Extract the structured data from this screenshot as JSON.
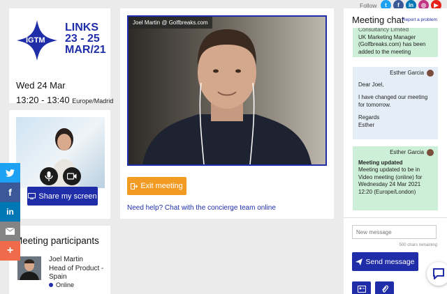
{
  "event": {
    "logo_acronym": "IGTM",
    "logo_line1": "LINKS",
    "logo_line2": "23 - 25",
    "logo_line3": "MAR/21",
    "date": "Wed 24 Mar",
    "time": "13:20 - 13:40",
    "timezone": "Europe/Madrid"
  },
  "self_video": {
    "mic_icon": "microphone-icon",
    "camera_icon": "video-camera-icon",
    "share_label": "Share my screen"
  },
  "participants": {
    "title": "Meeting participants",
    "items": [
      {
        "name": "Joel Martin",
        "role": "Head of Product - Spain",
        "status": "Online"
      }
    ]
  },
  "share_sidebar": [
    {
      "icon": "twitter-icon",
      "color": "#1da1f2"
    },
    {
      "icon": "facebook-icon",
      "color": "#3b5998"
    },
    {
      "icon": "linkedin-icon",
      "color": "#0077b5"
    },
    {
      "icon": "email-icon",
      "color": "#848484"
    },
    {
      "icon": "plus-icon",
      "color": "#ef6b4b"
    }
  ],
  "main_video": {
    "caller_label": "Joel Martin @ Golfbreaks.com",
    "exit_label": "Exit meeting",
    "help_text": "Need help? Chat with the concierge team online"
  },
  "follow": {
    "label": "Follow",
    "icons": [
      {
        "icon": "twitter-icon",
        "color": "#1da1f2"
      },
      {
        "icon": "facebook-icon",
        "color": "#3b5998"
      },
      {
        "icon": "linkedin-icon",
        "color": "#0077b5"
      },
      {
        "icon": "instagram-icon",
        "color": "#c13584"
      },
      {
        "icon": "youtube-icon",
        "color": "#e62117"
      }
    ]
  },
  "chat": {
    "title": "Meeting chat",
    "report": "Report a problem",
    "messages": [
      {
        "type": "system",
        "text_partial": "Consultancy Limited",
        "text": "UK Marketing Manager (Golfbreaks.com) has been added to the meeting"
      },
      {
        "type": "user",
        "sender": "Esther Garcia",
        "lines": [
          "Dear Joel,",
          "I have changed our meeting for tomorrow.",
          "Regards",
          "Esther"
        ]
      },
      {
        "type": "system",
        "sender": "Esther Garcia",
        "heading": "Meeting updated",
        "text": "Meeting updated to be in Video meeting (online) for Wednesday 24 Mar 2021 12:20 (Europe/London)"
      }
    ],
    "input_placeholder": "New message",
    "chars_remaining": "500 chars remaining",
    "send_label": "Send message"
  }
}
